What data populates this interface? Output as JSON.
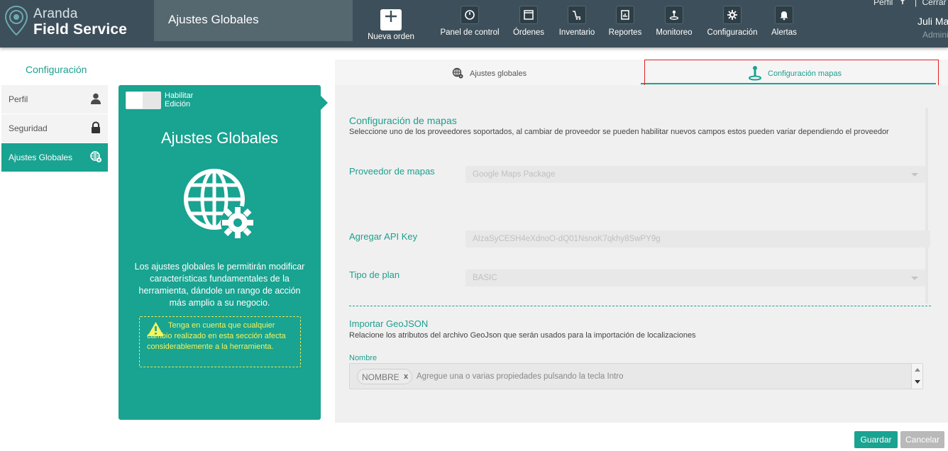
{
  "app": {
    "brand_line1": "Aranda",
    "brand_line2": "Field Service",
    "page_title": "Ajustes Globales"
  },
  "nav": {
    "new_order": "Nueva orden",
    "items": [
      {
        "label": "Panel de control",
        "icon": "dashboard-icon"
      },
      {
        "label": "Órdenes",
        "icon": "window-icon"
      },
      {
        "label": "Inventario",
        "icon": "cart-icon"
      },
      {
        "label": "Reportes",
        "icon": "report-icon"
      },
      {
        "label": "Monitoreo",
        "icon": "monitor-icon"
      },
      {
        "label": "Configuración",
        "icon": "gear-icon"
      },
      {
        "label": "Alertas",
        "icon": "bell-icon"
      }
    ]
  },
  "user": {
    "profile_link": "Perfil",
    "separator": "|",
    "logout_link": "Cerrar Sesió",
    "name": "Juli Mancera",
    "role": "Administrado"
  },
  "sidebar": {
    "title": "Configuración",
    "items": [
      {
        "label": "Perfil",
        "icon": "user-icon"
      },
      {
        "label": "Seguridad",
        "icon": "lock-icon"
      },
      {
        "label": "Ajustes Globales",
        "icon": "globe-gear-icon",
        "active": true
      }
    ]
  },
  "info_card": {
    "toggle_label": "Habilitar Edición",
    "title": "Ajustes Globales",
    "description": "Los ajustes globales le permitirán modificar características fundamentales de la herramienta, dándole un rango de acción más amplio a su negocio.",
    "warning": "Tenga en cuenta que cualquier cambio realizado en esta sección afecta considerablemente a la herramienta."
  },
  "tabs": {
    "global": "Ajustes globales",
    "maps": "Configuración mapas"
  },
  "maps_config": {
    "title": "Configuración de mapas",
    "subtitle": "Seleccione uno de los proveedores soportados, al cambiar de proveedor se pueden habilitar nuevos campos estos pueden variar dependiendo el proveedor",
    "provider_label": "Proveedor de mapas",
    "provider_value": "Google Maps Package",
    "api_key_label": "Agregar API Key",
    "api_key_value": "AIzaSyCESH4eXdnoO-dQ01NsnoK7qkhy8SwPY9g",
    "plan_label": "Tipo de plan",
    "plan_value": "BASIC"
  },
  "geojson": {
    "title": "Importar GeoJSON",
    "subtitle": "Relacione los atributos del archivo GeoJson que serán usados para la importación de localizaciones",
    "name_label": "Nombre",
    "tag": "NOMBRE",
    "tag_remove": "x",
    "placeholder": "Agregue una o varias propiedades pulsando la tecla Intro"
  },
  "actions": {
    "save": "Guardar",
    "cancel": "Cancelar"
  },
  "colors": {
    "teal": "#19a391",
    "header": "#3d4f5a",
    "warning": "#f4f45c",
    "highlight_box": "#e02020"
  }
}
